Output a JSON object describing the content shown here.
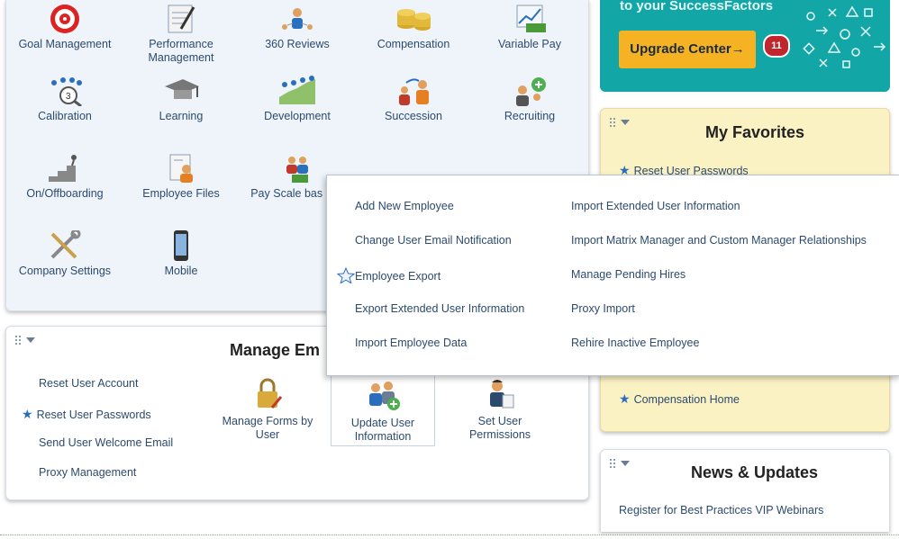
{
  "tools": {
    "row1": [
      "Goal Management",
      "Performance Management",
      "360 Reviews",
      "Compensation",
      "Variable Pay"
    ],
    "row2": [
      "Calibration",
      "Learning",
      "Development",
      "Succession",
      "Recruiting"
    ],
    "row3": [
      "On/Offboarding",
      "Employee Files",
      "Pay Scale bas pay"
    ],
    "row4": [
      "Company Settings",
      "Mobile"
    ]
  },
  "upgrade": {
    "header": "to your SuccessFactors",
    "button_label": "Upgrade Center",
    "button_arrow": "→",
    "badge_count": "11"
  },
  "favorites": {
    "title": "My Favorites",
    "items": [
      "Reset User Passwords",
      "Compensation Home"
    ]
  },
  "news": {
    "title": "News & Updates",
    "items": [
      "Register for Best Practices VIP Webinars"
    ]
  },
  "manage": {
    "title": "Manage Em",
    "links": [
      "Reset User Account",
      "Reset User Passwords",
      "Send User Welcome Email",
      "Proxy Management"
    ],
    "tiles": [
      {
        "label": "Manage Forms by User"
      },
      {
        "label": "Update User Information"
      },
      {
        "label": "Set User Permissions"
      }
    ]
  },
  "dropdown": {
    "left": [
      "Add New Employee",
      "Change User Email Notification",
      "Employee Export",
      "Export Extended User Information",
      "Import Employee Data"
    ],
    "right": [
      "Import Extended User Information",
      "Import Matrix Manager and Custom Manager Relationships",
      "Manage Pending Hires",
      "Proxy Import",
      "Rehire Inactive Employee"
    ]
  },
  "colors": {
    "teal": "#12a6a6",
    "upgrade_button": "#f5b324",
    "favorites_bg": "#fbf2c4",
    "tools_bg": "#eef4fa",
    "link": "#2c4a6e"
  }
}
